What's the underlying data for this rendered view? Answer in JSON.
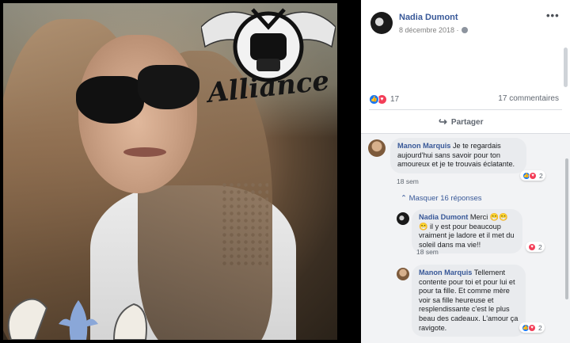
{
  "post": {
    "author": "Nadia Dumont",
    "date": "8 décembre 2018 ·",
    "reaction_count": "17",
    "comments_count": "17 commentaires",
    "share_label": "Partager",
    "photo_logo_text": "Alliance"
  },
  "comments": [
    {
      "name": "Manon Marquis",
      "text": "Je te regardais aujourd'hui sans savoir pour ton amoureux et je te trouvais éclatante.",
      "time": "18 sem",
      "reactions": "2"
    }
  ],
  "hide_replies_label": "Masquer 16 réponses",
  "replies": [
    {
      "name": "Nadia Dumont",
      "text": "Merci 😁😁😁 il y est pour beaucoup vraiment je ladore et il met du soleil dans ma vie!!",
      "time": "18 sem",
      "reactions": "2"
    },
    {
      "name": "Manon Marquis",
      "text": "Tellement contente pour toi et pour lui et pour ta fille. Et comme mère voir sa fille heureuse et resplendissante c'est le plus beau des cadeaux. L'amour ça ravigote.",
      "reactions": "2"
    }
  ],
  "colors": {
    "link": "#385898",
    "like": "#1877f2",
    "love": "#f33e58",
    "bubble": "#e9ebee"
  }
}
